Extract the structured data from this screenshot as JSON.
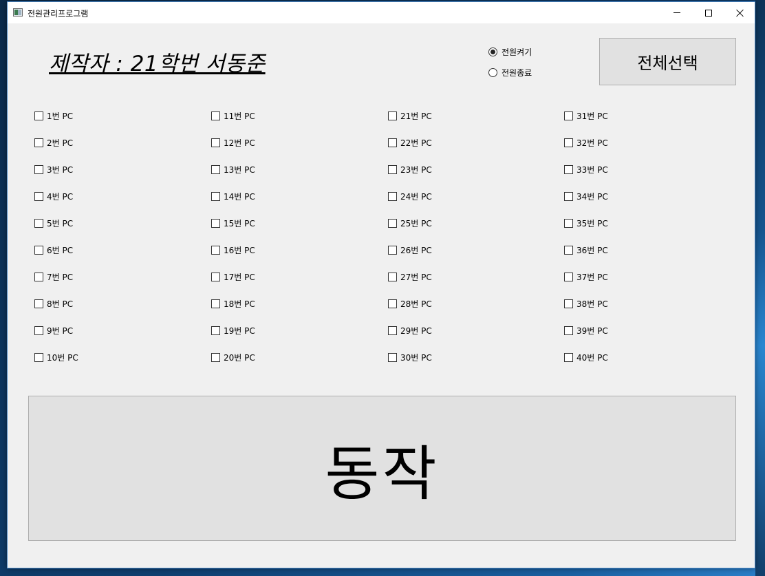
{
  "window": {
    "title": "전원관리프로그램"
  },
  "author_label": "제작자 : 21학번 서동준",
  "radios": [
    {
      "label": "전원켜기",
      "checked": true
    },
    {
      "label": "전원종료",
      "checked": false
    }
  ],
  "select_all_label": "전체선택",
  "pcs": [
    "1번 PC",
    "2번 PC",
    "3번 PC",
    "4번 PC",
    "5번 PC",
    "6번 PC",
    "7번 PC",
    "8번 PC",
    "9번 PC",
    "10번 PC",
    "11번 PC",
    "12번 PC",
    "13번 PC",
    "14번 PC",
    "15번 PC",
    "16번 PC",
    "17번 PC",
    "18번 PC",
    "19번 PC",
    "20번 PC",
    "21번 PC",
    "22번 PC",
    "23번 PC",
    "24번 PC",
    "25번 PC",
    "26번 PC",
    "27번 PC",
    "28번 PC",
    "29번 PC",
    "30번 PC",
    "31번 PC",
    "32번 PC",
    "33번 PC",
    "34번 PC",
    "35번 PC",
    "36번 PC",
    "37번 PC",
    "38번 PC",
    "39번 PC",
    "40번 PC"
  ],
  "action_label": "동작"
}
